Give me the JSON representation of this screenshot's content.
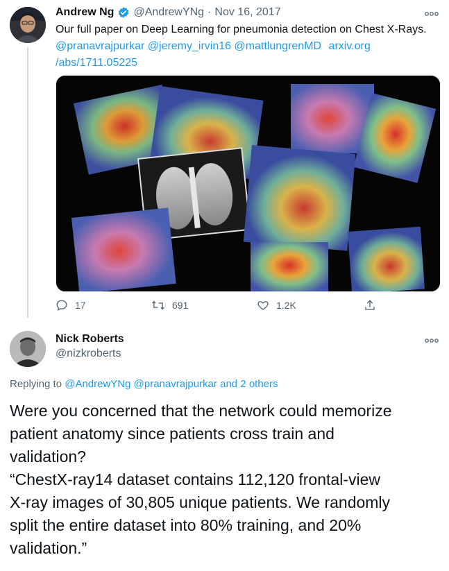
{
  "tweet": {
    "author_name": "Andrew Ng",
    "handle": "@AndrewYNg",
    "separator": "·",
    "date": "Nov 16, 2017",
    "text_line1": "Our full paper on Deep Learning for pneumonia detection on Chest X-Rays.",
    "mentions": "@pranavrajpurkar @jeremy_irvin16 @mattlungrenMD",
    "link_part1": "arxiv.org",
    "link_part2": "/abs/1711.05225",
    "more_icon": "more-icon",
    "verified_color": "#1d9bf0",
    "stats": {
      "replies": "17",
      "retweets": "691",
      "likes": "1.2K"
    }
  },
  "reply": {
    "author_name": "Nick Roberts",
    "handle": "@nizkroberts",
    "replying_to_label": "Replying to",
    "replying_to_users": "@AndrewYNg @pranavrajpurkar",
    "replying_to_and": "and 2 others",
    "text_lines": [
      "Were you concerned that the network could memorize",
      "patient anatomy since patients cross train and",
      "validation?",
      "“ChestX-ray14 dataset contains 112,120 frontal-view",
      "X-ray images of 30,805 unique patients. We randomly",
      "split the entire dataset into 80% training, and 20%",
      "validation.”"
    ]
  },
  "colors": {
    "link": "#1d9bf0",
    "secondary_text": "#536471",
    "primary_text": "#0f1419"
  }
}
